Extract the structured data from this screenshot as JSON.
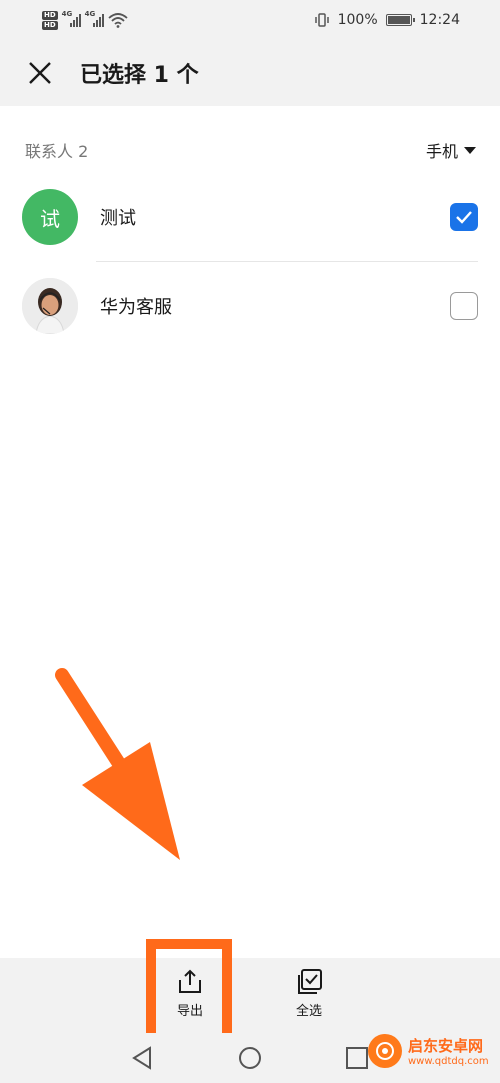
{
  "status_bar": {
    "hd_top": "HD",
    "hd_bottom": "HD",
    "sim1_network": "4G",
    "sim2_network": "4G",
    "battery_text": "100%",
    "time": "12:24",
    "icons": [
      "hd-icon",
      "signal-icon",
      "wifi-icon",
      "vibrate-icon",
      "battery-icon"
    ]
  },
  "header": {
    "title": "已选择 1 个",
    "close_icon": "close-icon"
  },
  "section": {
    "label": "联系人 2",
    "filter_label": "手机"
  },
  "contacts": [
    {
      "name": "测试",
      "avatar_letter": "试",
      "avatar_color": "#43b864",
      "checked": true
    },
    {
      "name": "华为客服",
      "avatar_letter": "",
      "avatar_type": "photo",
      "checked": false
    }
  ],
  "toolbar": {
    "export_label": "导出",
    "select_all_label": "全选"
  },
  "annotation": {
    "arrow_color": "#ff6a1a",
    "highlight_color": "#ff6a1a"
  },
  "watermark": {
    "main": "启东安卓网",
    "sub": "www.qdtdq.com"
  },
  "colors": {
    "accent_blue": "#1a73e8",
    "bar_gray": "#f2f2f2"
  }
}
